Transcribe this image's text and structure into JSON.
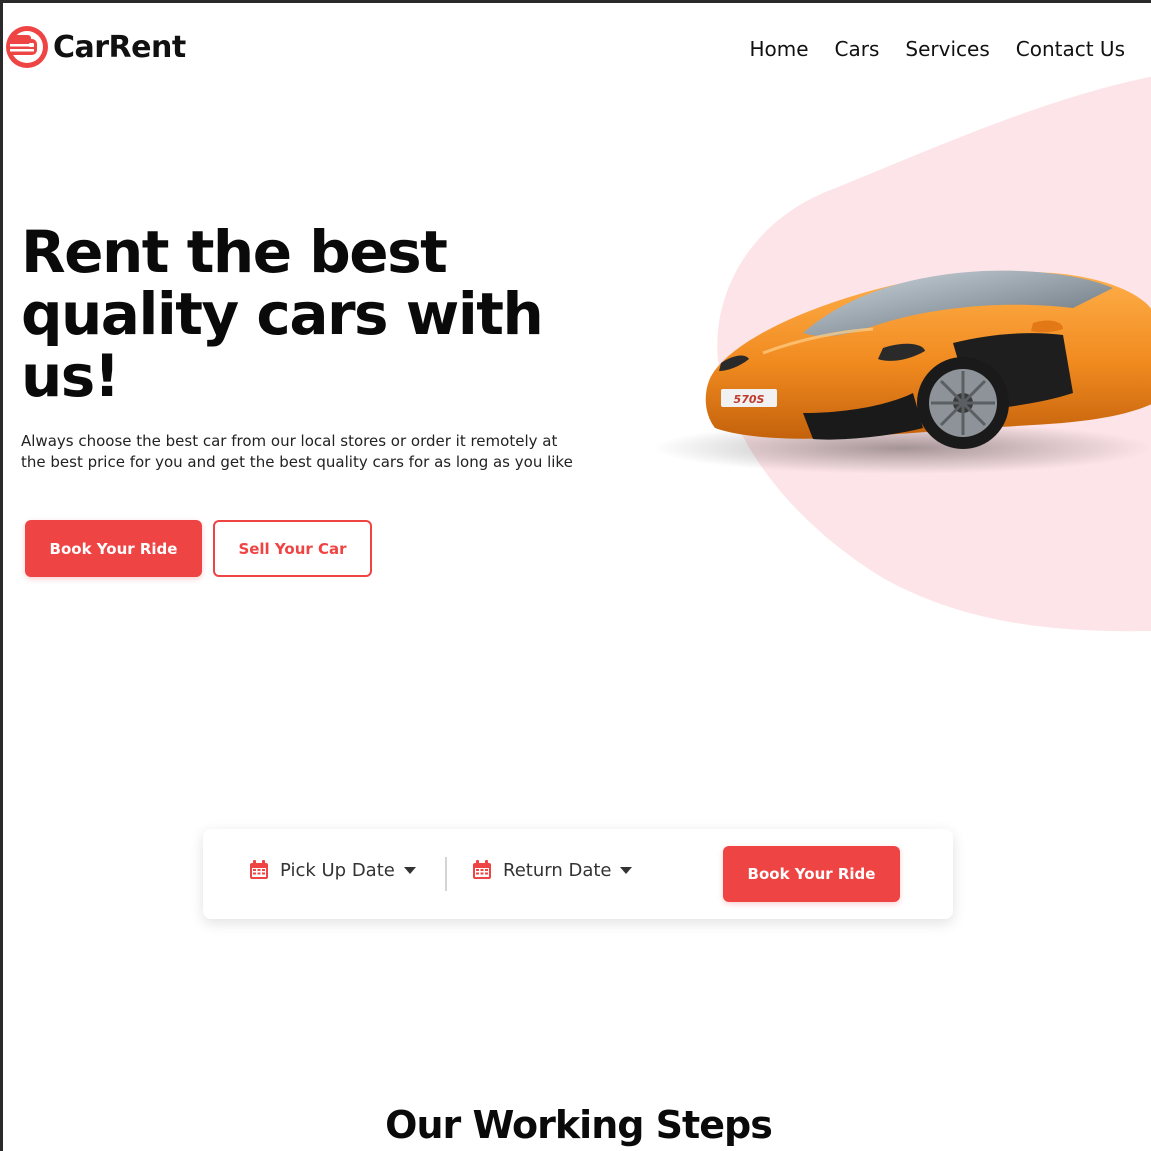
{
  "brand": {
    "name": "CarRent",
    "logo_icon": "car-front-icon",
    "accent_color": "#ef4444"
  },
  "nav": {
    "items": [
      {
        "label": "Home"
      },
      {
        "label": "Cars"
      },
      {
        "label": "Services"
      },
      {
        "label": "Contact Us"
      }
    ]
  },
  "hero": {
    "title": "Rent the best quality cars with us!",
    "subtitle": "Always choose the best car from our local stores or order it remotely at the best price for you and get the best quality cars for as long as you like",
    "primary_button": "Book Your Ride",
    "secondary_button": "Sell Your Car",
    "blob_color": "#fde4e8",
    "car_color": "#f08a1f",
    "car_plate": "570S"
  },
  "booking": {
    "pickup_label": "Pick Up Date",
    "return_label": "Return Date",
    "button": "Book Your Ride",
    "date_icon": "calendar-icon",
    "dropdown_icon": "caret-down-icon"
  },
  "section": {
    "title": "Our Working Steps"
  }
}
